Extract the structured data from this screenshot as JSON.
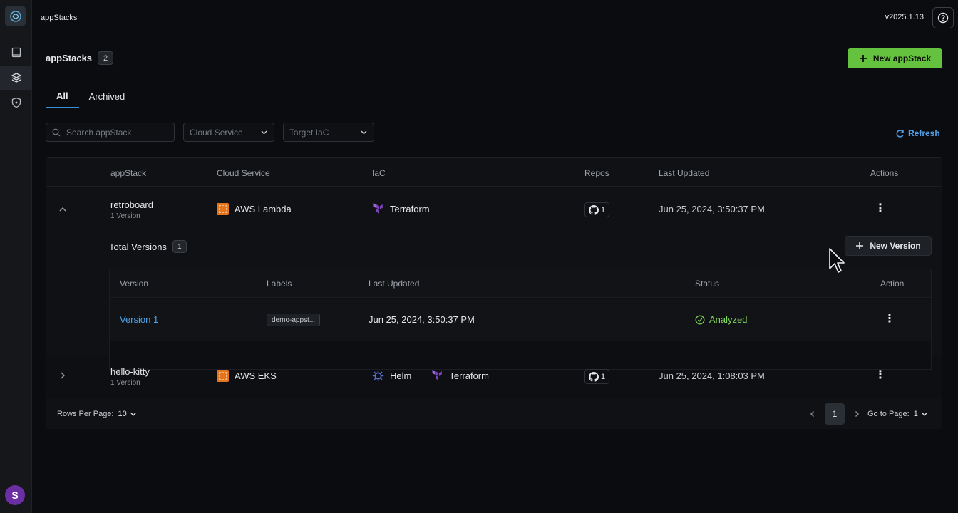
{
  "app": {
    "title": "appStacks",
    "version": "v2025.1.13",
    "avatar_initial": "S"
  },
  "sidebar": {
    "items": [
      {
        "icon": "book-icon"
      },
      {
        "icon": "layers-icon",
        "active": true
      },
      {
        "icon": "shield-icon"
      }
    ]
  },
  "page": {
    "title": "appStacks",
    "count": "2",
    "new_button": "New appStack",
    "tabs": [
      {
        "label": "All",
        "active": true
      },
      {
        "label": "Archived"
      }
    ],
    "search_placeholder": "Search appStack",
    "filter_cloud": "Cloud Service",
    "filter_iac": "Target IaC",
    "refresh": "Refresh"
  },
  "table": {
    "headers": {
      "appstack": "appStack",
      "cloud": "Cloud Service",
      "iac": "IaC",
      "repos": "Repos",
      "updated": "Last Updated",
      "actions": "Actions"
    },
    "rows": [
      {
        "name": "retroboard",
        "versions": "1 Version",
        "cloud": "AWS Lambda",
        "iac": [
          "Terraform"
        ],
        "repos": "1",
        "updated": "Jun 25, 2024, 3:50:37 PM",
        "expanded": true
      },
      {
        "name": "hello-kitty",
        "versions": "1 Version",
        "cloud": "AWS EKS",
        "iac": [
          "Helm",
          "Terraform"
        ],
        "repos": "1",
        "updated": "Jun 25, 2024, 1:08:03 PM",
        "expanded": false
      }
    ],
    "expanded": {
      "total_versions_label": "Total Versions",
      "total_versions": "1",
      "new_version": "New Version",
      "headers": {
        "version": "Version",
        "labels": "Labels",
        "updated": "Last Updated",
        "status": "Status",
        "action": "Action"
      },
      "rows": [
        {
          "version": "Version 1",
          "label": "demo-appst...",
          "updated": "Jun 25, 2024, 3:50:37 PM",
          "status": "Analyzed"
        }
      ]
    },
    "footer": {
      "rows_per_page_label": "Rows Per Page:",
      "rows_per_page": "10",
      "current_page": "1",
      "goto_label": "Go to Page:",
      "goto_value": "1"
    }
  },
  "colors": {
    "accent_green": "#65c23f",
    "link_blue": "#4ea1e8",
    "status_green": "#7fd35a",
    "aws_orange": "#e4751f",
    "terraform_purple": "#7b42bc"
  }
}
